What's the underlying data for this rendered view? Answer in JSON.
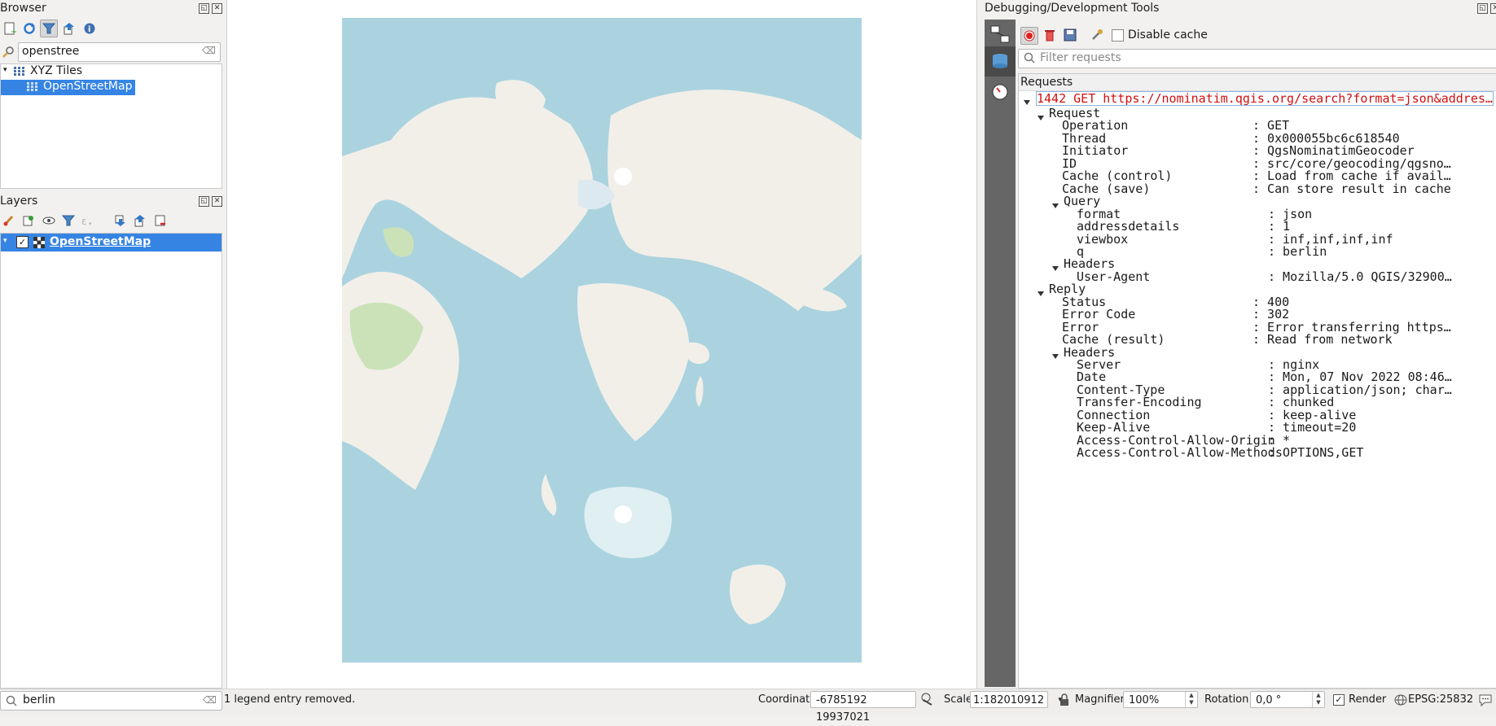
{
  "browser": {
    "title": "Browser",
    "search_value": "openstree",
    "tree": [
      {
        "label": "XYZ Tiles"
      },
      {
        "label": "OpenStreetMap"
      }
    ]
  },
  "layers": {
    "title": "Layers",
    "items": [
      {
        "label": "OpenStreetMap"
      }
    ]
  },
  "debug": {
    "title": "Debugging/Development Tools",
    "disable_cache_label": "Disable cache",
    "filter_placeholder": "Filter requests",
    "requests_header": "Requests",
    "request_line": "1442 GET https://nominatim.qgis.org/search?format=json&addres…",
    "rows": [
      {
        "key": "Request",
        "value": ""
      },
      {
        "key": "Operation",
        "value": ": GET"
      },
      {
        "key": "Thread",
        "value": ": 0x000055bc6c618540"
      },
      {
        "key": "Initiator",
        "value": ": QgsNominatimGeocoder"
      },
      {
        "key": "ID",
        "value": ": src/core/geocoding/qgsno…"
      },
      {
        "key": "Cache (control)",
        "value": ": Load from cache if avail…"
      },
      {
        "key": "Cache (save)",
        "value": ": Can store result in cache"
      },
      {
        "key": "Query",
        "value": ""
      },
      {
        "key": "format",
        "value": ": json"
      },
      {
        "key": "addressdetails",
        "value": ": 1"
      },
      {
        "key": "viewbox",
        "value": ": inf,inf,inf,inf"
      },
      {
        "key": "q",
        "value": ": berlin"
      },
      {
        "key": "Headers",
        "value": ""
      },
      {
        "key": "User-Agent",
        "value": ": Mozilla/5.0 QGIS/32900…"
      },
      {
        "key": "Reply",
        "value": ""
      },
      {
        "key": "Status",
        "value": ": 400"
      },
      {
        "key": "Error Code",
        "value": ": 302"
      },
      {
        "key": "Error",
        "value": ": Error transferring https…"
      },
      {
        "key": "Cache (result)",
        "value": ": Read from network"
      },
      {
        "key": "Headers",
        "value": ""
      },
      {
        "key": "Server",
        "value": ": nginx"
      },
      {
        "key": "Date",
        "value": ": Mon, 07 Nov 2022 08:46…"
      },
      {
        "key": "Content-Type",
        "value": ": application/json; char…"
      },
      {
        "key": "Transfer-Encoding",
        "value": ": chunked"
      },
      {
        "key": "Connection",
        "value": ": keep-alive"
      },
      {
        "key": "Keep-Alive",
        "value": ": timeout=20"
      },
      {
        "key": "Access-Control-Allow-Origin",
        "value": ": *"
      },
      {
        "key": "Access-Control-Allow-Methods",
        "value": ": OPTIONS,GET"
      }
    ]
  },
  "statusbar": {
    "locator_value": "berlin",
    "message": "1 legend entry removed.",
    "coordinate_label": "Coordinate",
    "coordinate_value": "-6785192  19937021",
    "scale_label": "Scale",
    "scale_value": "1:182010912",
    "magnifier_label": "Magnifier",
    "magnifier_value": "100%",
    "rotation_label": "Rotation",
    "rotation_value": "0,0 °",
    "render_label": "Render",
    "crs_label": "EPSG:25832"
  },
  "colors": {
    "selection": "#3584e4",
    "ocean": "#aad3df",
    "land": "#f2efe9",
    "error_text": "#d01010"
  }
}
